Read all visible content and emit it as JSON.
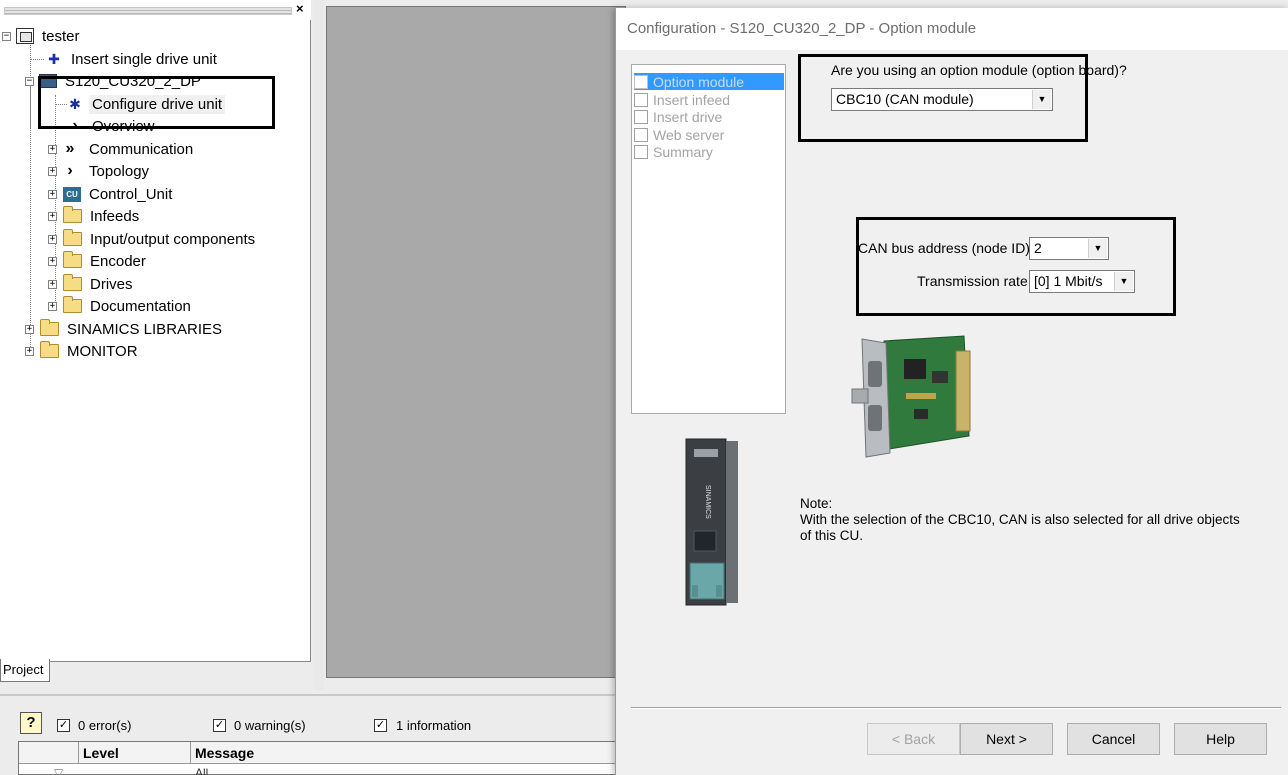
{
  "tree": {
    "close_glyph": "×",
    "items": [
      {
        "label": "tester"
      },
      {
        "label": "Insert single drive unit"
      },
      {
        "label": "S120_CU320_2_DP"
      },
      {
        "label": "Configure drive unit"
      },
      {
        "label": "Overview"
      },
      {
        "label": "Communication"
      },
      {
        "label": "Topology"
      },
      {
        "label": "Control_Unit"
      },
      {
        "label": "Infeeds"
      },
      {
        "label": "Input/output components"
      },
      {
        "label": "Encoder"
      },
      {
        "label": "Drives"
      },
      {
        "label": "Documentation"
      },
      {
        "label": "SINAMICS LIBRARIES"
      },
      {
        "label": "MONITOR"
      }
    ],
    "cu_icon_text": "CU",
    "tab_label": "Project"
  },
  "message_bar": {
    "help_glyph": "?",
    "filters": [
      {
        "label": "0 error(s)",
        "checked": true
      },
      {
        "label": "0 warning(s)",
        "checked": true
      },
      {
        "label": "1 information",
        "checked": true
      }
    ],
    "columns": [
      "Level",
      "Message"
    ],
    "first_row_message": "All"
  },
  "dialog": {
    "title": "Configuration - S120_CU320_2_DP - Option module",
    "steps": [
      {
        "label": "Option module",
        "active": true
      },
      {
        "label": "Insert infeed",
        "active": false
      },
      {
        "label": "Insert drive",
        "active": false
      },
      {
        "label": "Web server",
        "active": false
      },
      {
        "label": "Summary",
        "active": false
      }
    ],
    "question": "Are you using an option module (option board)?",
    "option_module_value": "CBC10 (CAN module)",
    "can_address_label": "CAN bus address (node ID):",
    "can_address_value": "2",
    "transmission_label": "Transmission rate:",
    "transmission_value": "[0] 1 Mbit/s",
    "device_brand_text": "SINAMICS",
    "note_title": "Note:",
    "note_text": "With the selection of the CBC10, CAN is also selected for all drive objects of this CU.",
    "buttons": {
      "back": "< Back",
      "next": "Next >",
      "cancel": "Cancel",
      "help": "Help"
    }
  },
  "colors": {
    "selection_blue": "#3399ff",
    "workspace_gray": "#a9a9a9",
    "annotation": "#000000"
  }
}
